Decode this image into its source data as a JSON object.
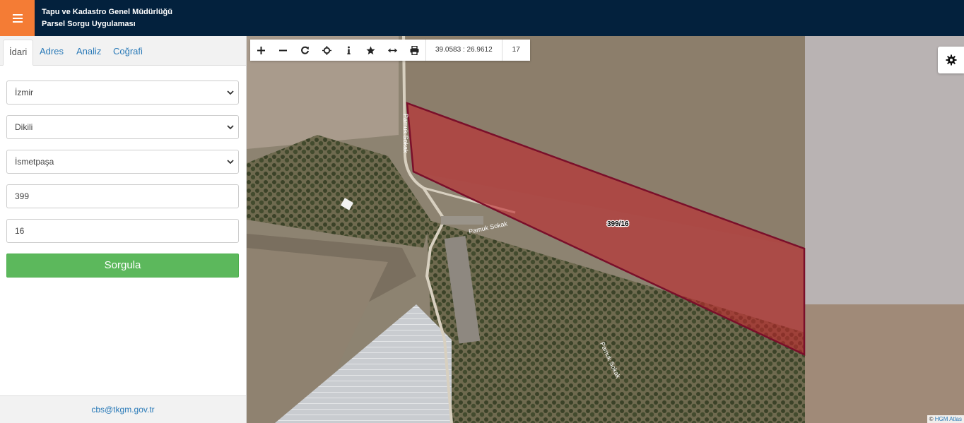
{
  "header": {
    "title_line1": "Tapu ve Kadastro Genel Müdürlüğü",
    "title_line2": "Parsel Sorgu Uygulaması",
    "accent_color": "#f47c35",
    "bar_color": "#03213d"
  },
  "tabs": [
    {
      "label": "İdari",
      "active": true
    },
    {
      "label": "Adres",
      "active": false
    },
    {
      "label": "Analiz",
      "active": false
    },
    {
      "label": "Coğrafi",
      "active": false
    }
  ],
  "form": {
    "il": "İzmir",
    "ilce": "Dikili",
    "mahalle": "İsmetpaşa",
    "ada": "399",
    "parsel": "16",
    "submit_label": "Sorgula"
  },
  "footer": {
    "email": "cbs@tkgm.gov.tr"
  },
  "map": {
    "coordinates": "39.0583 : 26.9612",
    "zoom": "17",
    "parcel_label": "399/16",
    "street_labels": [
      "Pamuk Sokak",
      "Pamuk Sokak",
      "Pamuk Sokak"
    ],
    "attribution_prefix": "©",
    "attribution_link": "HGM Atlas",
    "parcel_color": "#c0262c",
    "parcel_border": "#7a0f2a"
  },
  "toolbar": {
    "tools": [
      "zoom-in-icon",
      "zoom-out-icon",
      "refresh-icon",
      "locate-icon",
      "info-icon",
      "star-icon",
      "measure-icon",
      "print-icon"
    ]
  }
}
